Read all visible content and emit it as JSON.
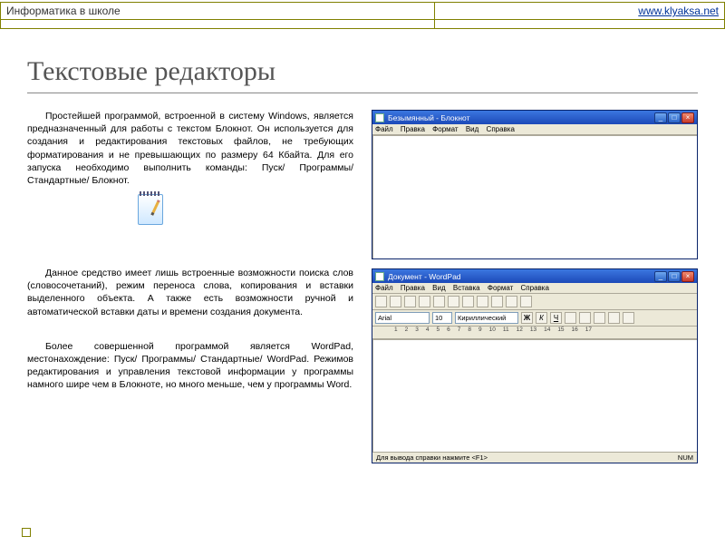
{
  "header": {
    "left": "Информатика в школе",
    "link": "www.klyaksa.net"
  },
  "title": "Текстовые редакторы",
  "paragraphs": {
    "p1": "Простейшей программой, встроенной в систему Windows, является предназначенный для работы с текстом Блокнот. Он используется для создания и редактирования текстовых файлов, не требующих форматирования и не превышающих по размеру 64 Кбайта. Для его запуска необходимо выполнить команды: Пуск/ Программы/ Стандартные/ Блокнот.",
    "p2": "Данное средство имеет лишь встроенные возможности поиска слов (словосочетаний), режим переноса слова, копирования и вставки выделенного объекта. А также есть возможности ручной и автоматической вставки даты и времени создания документа.",
    "p3": "Более совершенной программой является WordPad, местонахождение: Пуск/ Программы/ Стандартные/ WordPad. Режимов редактирования и управления текстовой информации у программы намного шире чем в Блокноте, но много меньше, чем у программы Word."
  },
  "notepad": {
    "title": "Безымянный - Блокнот",
    "menu": [
      "Файл",
      "Правка",
      "Формат",
      "Вид",
      "Справка"
    ]
  },
  "wordpad": {
    "title": "Документ - WordPad",
    "menu": [
      "Файл",
      "Правка",
      "Вид",
      "Вставка",
      "Формат",
      "Справка"
    ],
    "font": "Arial",
    "size": "10",
    "charset": "Кириллический",
    "status_left": "Для вывода справки нажмите <F1>",
    "status_right": "NUM",
    "ruler_marks": [
      "1",
      "2",
      "3",
      "4",
      "5",
      "6",
      "7",
      "8",
      "9",
      "10",
      "11",
      "12",
      "13",
      "14",
      "15",
      "16",
      "17"
    ],
    "style_buttons": [
      "Ж",
      "К",
      "Ч"
    ]
  }
}
